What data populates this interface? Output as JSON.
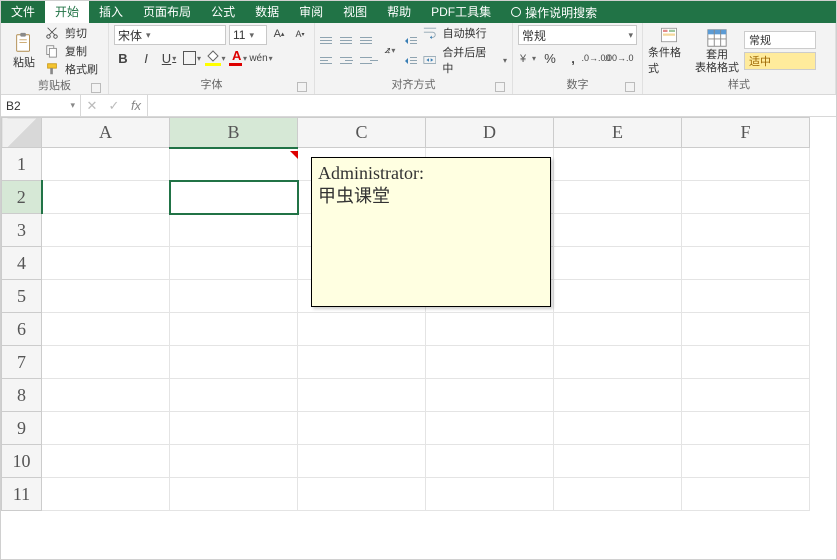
{
  "menu": {
    "file": "文件",
    "home": "开始",
    "insert": "插入",
    "layout": "页面布局",
    "formulas": "公式",
    "data": "数据",
    "review": "审阅",
    "view": "视图",
    "help": "帮助",
    "pdf": "PDF工具集",
    "search_hint": "操作说明搜索"
  },
  "ribbon": {
    "clipboard": {
      "paste": "粘贴",
      "cut": "剪切",
      "copy": "复制",
      "painter": "格式刷",
      "group": "剪贴板"
    },
    "font": {
      "family": "宋体",
      "size": "11",
      "group": "字体"
    },
    "align": {
      "wrap": "自动换行",
      "merge": "合并后居中",
      "group": "对齐方式"
    },
    "number": {
      "format": "常规",
      "group": "数字"
    },
    "styles": {
      "cond": "条件格式",
      "table": "套用\n表格格式",
      "normal": "常规",
      "good": "适中",
      "group": "样式"
    }
  },
  "namebox": "B2",
  "columns": [
    "A",
    "B",
    "C",
    "D",
    "E",
    "F"
  ],
  "rows": [
    "1",
    "2",
    "3",
    "4",
    "5",
    "6",
    "7",
    "8",
    "9",
    "10",
    "11"
  ],
  "selected_cell": "B2",
  "comment": {
    "author": "Administrator:",
    "text": "甲虫课堂"
  }
}
